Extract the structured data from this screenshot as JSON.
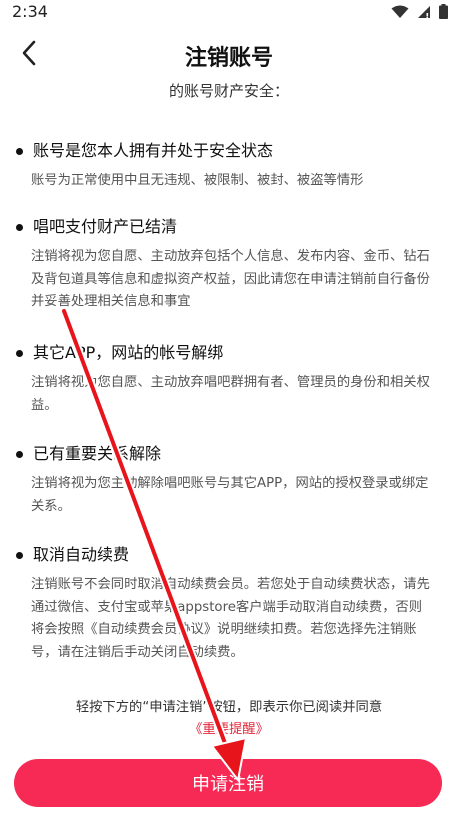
{
  "status_bar": {
    "time": "2:34",
    "icons": [
      "wifi-icon",
      "signal-icon",
      "battery-icon"
    ]
  },
  "nav": {
    "title": "注销账号",
    "back_icon": "chevron-left-icon"
  },
  "subtitle": "的账号财产安全：",
  "sections": [
    {
      "title": "账号是您本人拥有并处于安全状态",
      "description": "账号为正常使用中且无违规、被限制、被封、被盗等情形"
    },
    {
      "title": "唱吧支付财产已结清",
      "description": "注销将视为您自愿、主动放弃包括个人信息、发布内容、金币、钻石及背包道具等信息和虚拟资产权益，因此请您在申请注销前自行备份并妥善处理相关信息和事宜"
    },
    {
      "title": "其它APP，网站的帐号解绑",
      "description": "注销将视为您自愿、主动放弃唱吧群拥有者、管理员的身份和相关权益。"
    },
    {
      "title": "已有重要关系解除",
      "description": "注销将视为您主动解除唱吧账号与其它APP，网站的授权登录或绑定关系。"
    },
    {
      "title": "取消自动续费",
      "description": "注销账号不会同时取消自动续费会员。若您处于自动续费状态，请先通过微信、支付宝或苹果appstore客户端手动取消自动续费，否则将会按照《自动续费会员协议》说明继续扣费。若您选择先注销账号，请在注销后手动关闭自动续费。"
    }
  ],
  "notice": "轻按下方的“申请注销”按钮，即表示你已阅读并同意",
  "agreement_link": "《重要提醒》",
  "apply_button": "申请注销",
  "colors": {
    "accent": "#f72a56",
    "link": "#e0283c",
    "annotation": "#e8141c"
  }
}
